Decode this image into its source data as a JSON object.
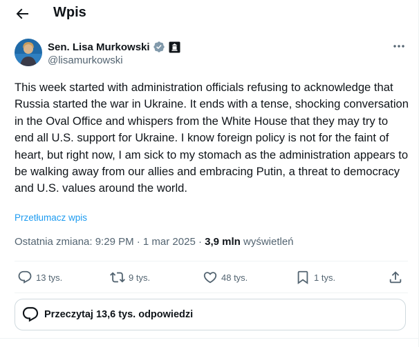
{
  "header": {
    "title": "Wpis"
  },
  "author": {
    "name": "Sen. Lisa Murkowski",
    "handle": "@lisamurkowski"
  },
  "post": {
    "text": "This week started with administration officials refusing to acknowledge that Russia started the war in Ukraine. It ends with a tense, shocking conversation in the Oval Office and whispers from the White House that they may try to end all U.S. support for Ukraine. I know foreign policy is not for the faint of heart, but right now, I am sick to my stomach as the administration appears to be walking away from our allies and embracing Putin, a threat to democracy and U.S. values around the world.",
    "translate_label": "Przetłumacz wpis",
    "meta_prefix": "Ostatnia zmiana: 9:29 PM · 1 mar 2025 · ",
    "views_count": "3,9 mln",
    "views_label": " wyświetleń"
  },
  "actions": {
    "replies": "13 tys.",
    "reposts": "9 tys.",
    "likes": "48 tys.",
    "bookmarks": "1 tys."
  },
  "replies_button": {
    "label": "Przeczytaj 13,6 tys. odpowiedzi"
  },
  "icons": {
    "back": "arrow-left-icon",
    "verified": "verified-badge-icon",
    "government": "government-badge-icon",
    "more": "more-dots-icon",
    "reply": "reply-icon",
    "repost": "repost-icon",
    "like": "heart-icon",
    "bookmark": "bookmark-icon",
    "share": "share-icon"
  },
  "colors": {
    "accent": "#1d9bf0",
    "text": "#0f1419",
    "secondary": "#536471",
    "border": "#cfd9de"
  }
}
